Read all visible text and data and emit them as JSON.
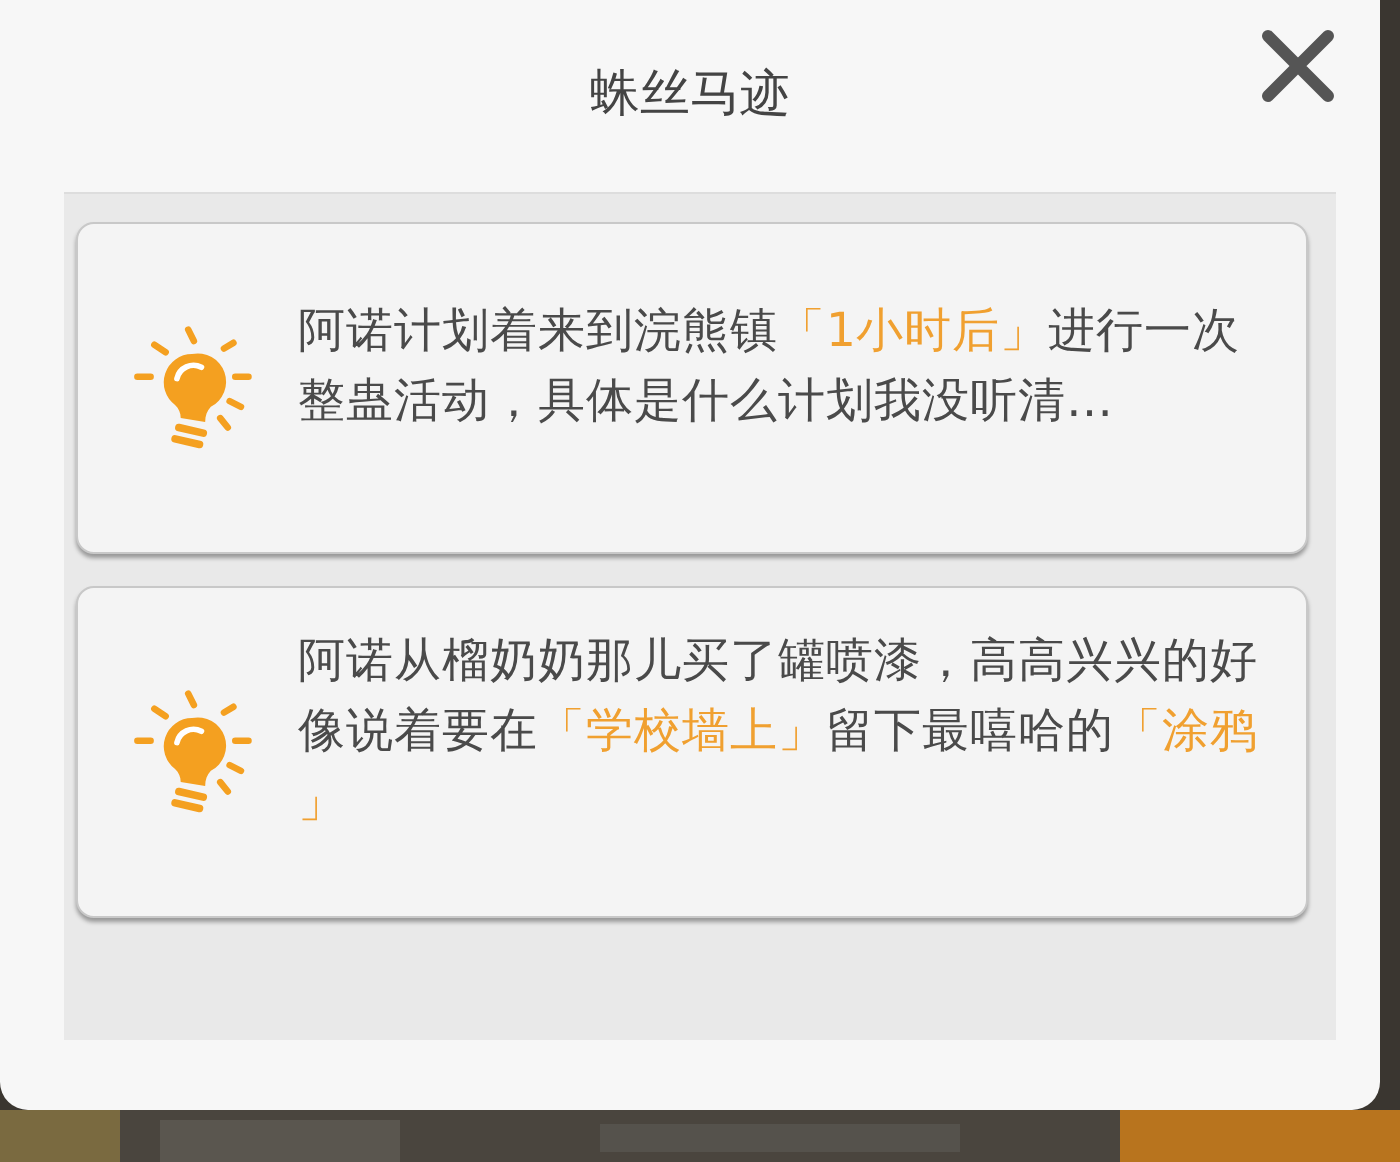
{
  "dialog": {
    "title": "蛛丝马迹"
  },
  "clues": [
    {
      "segments": [
        {
          "text": "阿诺计划着来到浣熊镇",
          "highlight": false
        },
        {
          "text": "「1小时后」",
          "highlight": true
        },
        {
          "text": "进行一次整蛊活动，具体是什么计划我没听清…",
          "highlight": false
        }
      ]
    },
    {
      "segments": [
        {
          "text": "阿诺从榴奶奶那儿买了罐喷漆，高高兴兴的好像说着要在",
          "highlight": false
        },
        {
          "text": "「学校墙上」",
          "highlight": true
        },
        {
          "text": "留下最嘻哈的",
          "highlight": false
        },
        {
          "text": "「涂鸦」",
          "highlight": true
        }
      ]
    }
  ]
}
